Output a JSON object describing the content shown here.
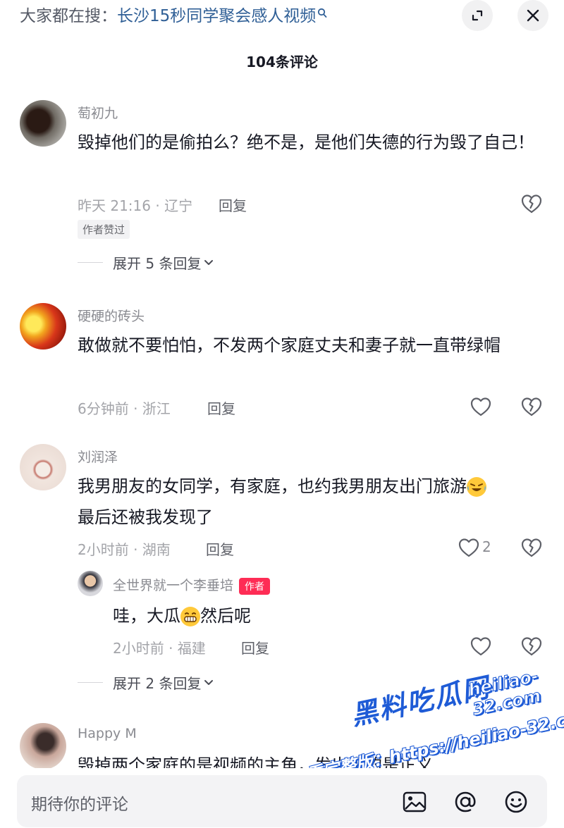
{
  "header": {
    "search_prefix": "大家都在搜：",
    "search_term": "长沙15秒同学聚会感人视频",
    "comment_count_title": "104条评论"
  },
  "comments": [
    {
      "username": "萄初九",
      "text": "毁掉他们的是偷拍么？绝不是，是他们失德的行为毁了自己！",
      "meta": "昨天 21:16 · 辽宁",
      "reply_label": "回复",
      "author_liked": "作者赞过",
      "expand_label": "展开 5 条回复"
    },
    {
      "username": "硬硬的砖头",
      "text": "敢做就不要怕怕，不发两个家庭丈夫和妻子就一直带绿帽",
      "meta": "6分钟前 · 浙江",
      "reply_label": "回复"
    },
    {
      "username": "刘润泽",
      "text": "我男朋友的女同学，有家庭，也约我男朋友出门旅游",
      "text2": "最后还被我发现了",
      "meta": "2小时前 · 湖南",
      "reply_label": "回复",
      "like_count": "2",
      "reply": {
        "username": "全世界就一个李垂培",
        "badge": "作者",
        "text_a": "哇，大瓜",
        "text_b": "然后呢",
        "meta": "2小时前 · 福建",
        "reply_label": "回复"
      },
      "expand_label": "展开 2 条回复"
    },
    {
      "username": "Happy M",
      "text": "毁掉两个家庭的是视频的主角，发出来的是正义"
    }
  ],
  "watermark": {
    "brand": "黑料吃瓜网",
    "url": "heiliao-32.com",
    "line2": "看完整版：https://heiliao-32.com"
  },
  "footer": {
    "input_placeholder": "期待你的评论"
  },
  "colors": {
    "author_badge": "#fe2c55",
    "search_link": "#2f5f96",
    "watermark_blue": "#1e5bd6"
  }
}
